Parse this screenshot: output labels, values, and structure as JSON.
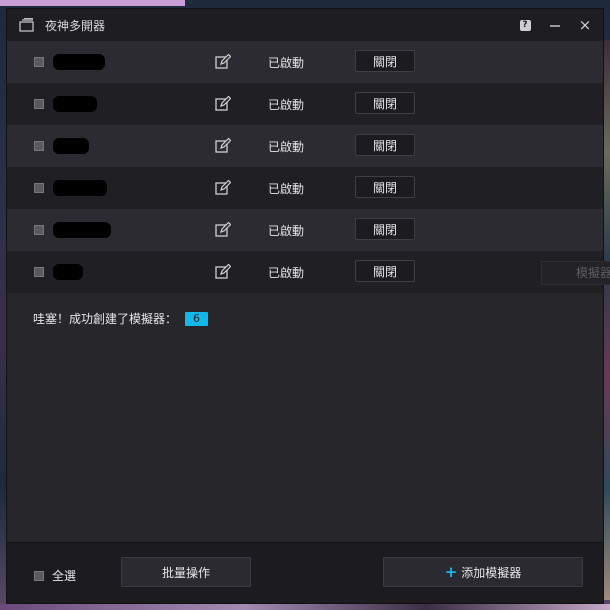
{
  "window": {
    "title": "夜神多開器",
    "icons": {
      "app": "multi-window-icon",
      "help": "help-icon",
      "minimize": "minimize-icon",
      "close": "close-icon"
    },
    "help_label": "?",
    "close_label": "×"
  },
  "rows": [
    {
      "status": "已啟動",
      "action": "關閉"
    },
    {
      "status": "已啟動",
      "action": "關閉"
    },
    {
      "status": "已啟動",
      "action": "關閉"
    },
    {
      "status": "已啟動",
      "action": "關閉"
    },
    {
      "status": "已啟動",
      "action": "關閉"
    },
    {
      "status": "已啟動",
      "action": "關閉"
    }
  ],
  "message": {
    "text": "哇塞！成功創建了模擬器：",
    "count": "6"
  },
  "footer": {
    "select_all": "全選",
    "batch": "批量操作",
    "add_plus": "+",
    "add": "添加模擬器"
  },
  "background_tab": {
    "label": "模擬器"
  },
  "colors": {
    "accent": "#13b8ea",
    "window_bg": "#26262b"
  }
}
